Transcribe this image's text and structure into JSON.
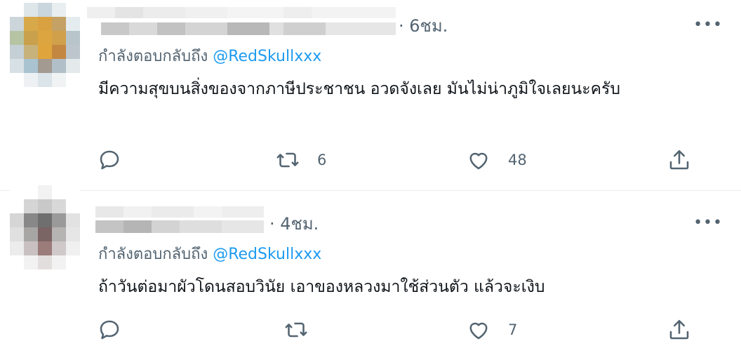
{
  "tweets": [
    {
      "time": "· 6ชม.",
      "more": "•••",
      "replying_prefix": "กำลังตอบกลับถึง",
      "replying_handle": "@RedSkullxxx",
      "text": "มีความสุขบนสิ่งของจากภาษีประชาชน อวดจังเลย มันไม่น่าภูมิใจเลยนะครับ",
      "actions": {
        "reply_count": "",
        "retweet_count": "6",
        "like_count": "48"
      },
      "icons": [
        "reply-icon",
        "retweet-icon",
        "like-icon",
        "share-icon"
      ]
    },
    {
      "time": "· 4ชม.",
      "more": "•••",
      "replying_prefix": "กำลังตอบกลับถึง",
      "replying_handle": "@RedSkullxxx",
      "text": "ถ้าวันต่อมาผัวโดนสอบวินัย เอาของหลวงมาใช้ส่วนตัว แล้วจะเงิบ",
      "actions": {
        "reply_count": "",
        "retweet_count": "",
        "like_count": "7"
      },
      "icons": [
        "reply-icon",
        "retweet-icon",
        "like-icon",
        "share-icon"
      ]
    }
  ],
  "colors": {
    "muted": "#536471",
    "link": "#1d9bf0",
    "text": "#0f1419",
    "divider": "#e6ecf0"
  }
}
